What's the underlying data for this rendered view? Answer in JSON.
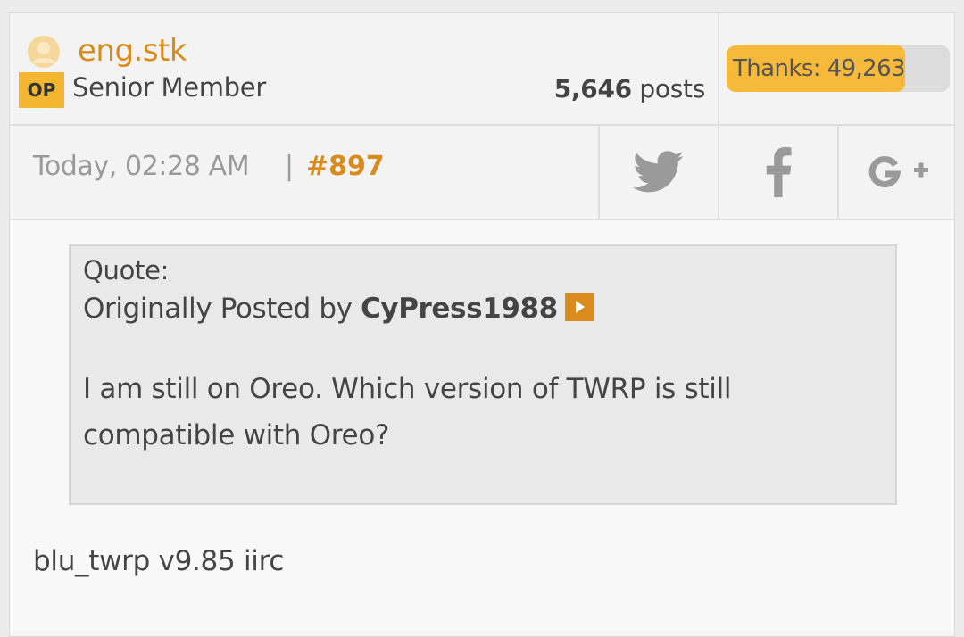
{
  "user": {
    "username": "eng.stk",
    "badge": "OP",
    "rank": "Senior Member",
    "post_count": "5,646",
    "posts_label": " posts"
  },
  "thanks": {
    "label": "Thanks: 49,263",
    "fill_fraction": 0.8
  },
  "meta": {
    "date": "Today, 02:28 AM",
    "separator": "|",
    "post_number": "#897"
  },
  "share": {
    "icons": [
      "twitter-icon",
      "facebook-icon",
      "google-plus-icon"
    ]
  },
  "quote": {
    "label": "Quote:",
    "by_prefix": "Originally Posted by ",
    "author": "CyPress1988",
    "text": "I am still on Oreo. Which version of TWRP is still compatible with Oreo?"
  },
  "reply": {
    "text": "blu_twrp v9.85 iirc"
  },
  "colors": {
    "accent": "#d98b1c",
    "badge": "#f4b630",
    "thanks_fill": "#f6b93a",
    "icon_gray": "#9a9a9a"
  }
}
